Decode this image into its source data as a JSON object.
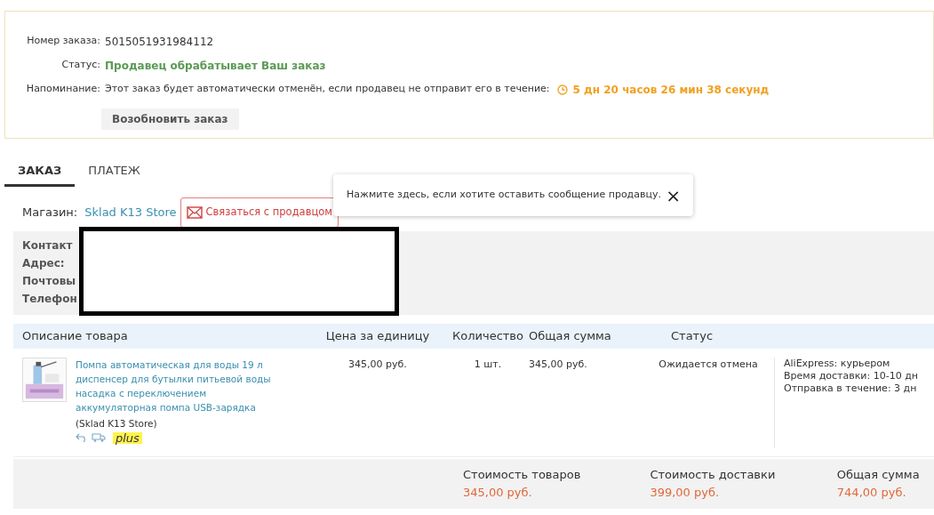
{
  "order_info": {
    "number_label": "Номер заказа:",
    "number": "5015051931984112",
    "status_label": "Статус:",
    "status": "Продавец обрабатывает Ваш заказ",
    "reminder_label": "Напоминание:",
    "reminder": "Этот заказ будет автоматически отменён, если продавец не отправит его в течение:",
    "countdown": "5 дн 20 часов 26 мин 38 секунд",
    "resume_button": "Возобновить заказ"
  },
  "tabs": [
    {
      "label": "ЗАКАЗ",
      "selected": true
    },
    {
      "label": "ПЛАТЕЖ",
      "selected": false
    }
  ],
  "store": {
    "label": "Магазин:",
    "name": "Sklad K13 Store",
    "contact_button": "Связаться с продавцом"
  },
  "tooltip": {
    "text": "Нажмите здесь, если хотите оставить сообщение продавцу.",
    "close": "×"
  },
  "address": {
    "labels": [
      "Контакт",
      "Адрес:",
      "Почтовы",
      "Телефон"
    ]
  },
  "table": {
    "columns": [
      "Описание товара",
      "Цена за единицу",
      "Количество",
      "Общая сумма",
      "Статус"
    ],
    "rows": [
      {
        "title": "Помпа автоматическая для воды 19 л диспенсер для бутылки питьевой воды насадка с переключением аккумуляторная помпа USB-зарядка",
        "store": "(Sklad K13 Store)",
        "badge": "plus",
        "price": "345,00 руб.",
        "quantity": "1 шт.",
        "total": "345,00 руб.",
        "status": "Ожидается отмена",
        "shipping": [
          "AliExpress: курьером",
          "Время доставки: 10-10 дн",
          "Отправка в течение: 3 дн"
        ]
      }
    ]
  },
  "summary": [
    {
      "label": "Стоимость товаров",
      "value": "345,00 руб."
    },
    {
      "label": "Стоимость доставки",
      "value": "399,00 руб."
    },
    {
      "label": "Общая сумма",
      "value": "744,00 руб."
    }
  ]
}
